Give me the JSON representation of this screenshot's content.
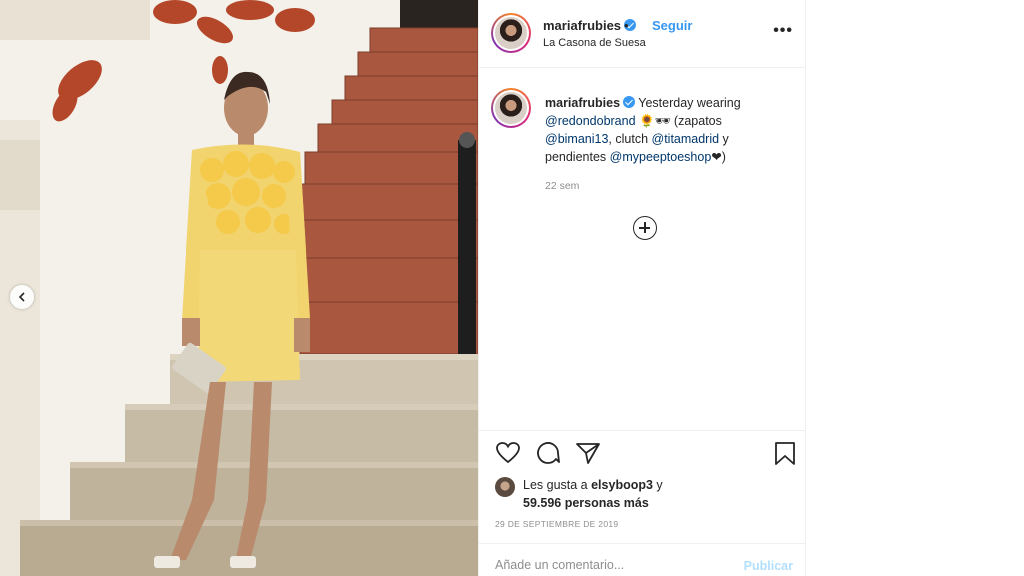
{
  "post": {
    "username": "mariafrubies",
    "separator": "•",
    "follow_label": "Seguir",
    "location": "La Casona de Suesa",
    "more_label": "•••"
  },
  "caption": {
    "username": "mariafrubies",
    "text_1": " Yesterday wearing ",
    "mention_1": "@redondobrand",
    "text_2": " 🌻🕶 (zapatos ",
    "mention_2": "@bimani13",
    "text_3": ", clutch ",
    "mention_3": "@titamadrid",
    "text_4": " y pendientes ",
    "mention_4": "@mypeeptoeshop",
    "text_5": "❤)",
    "time": "22 sem"
  },
  "likes": {
    "prefix": "Les gusta a ",
    "user": "elsyboop3",
    "mid": " y",
    "count": "59.596 personas más"
  },
  "date": "29 DE SEPTIEMBRE DE 2019",
  "comment_input": {
    "placeholder": "Añade un comentario..."
  },
  "publish_label": "Publicar",
  "icons": [
    "chevron-left-icon",
    "heart-icon",
    "comment-icon",
    "share-icon",
    "bookmark-icon",
    "add-icon",
    "verified-icon"
  ]
}
